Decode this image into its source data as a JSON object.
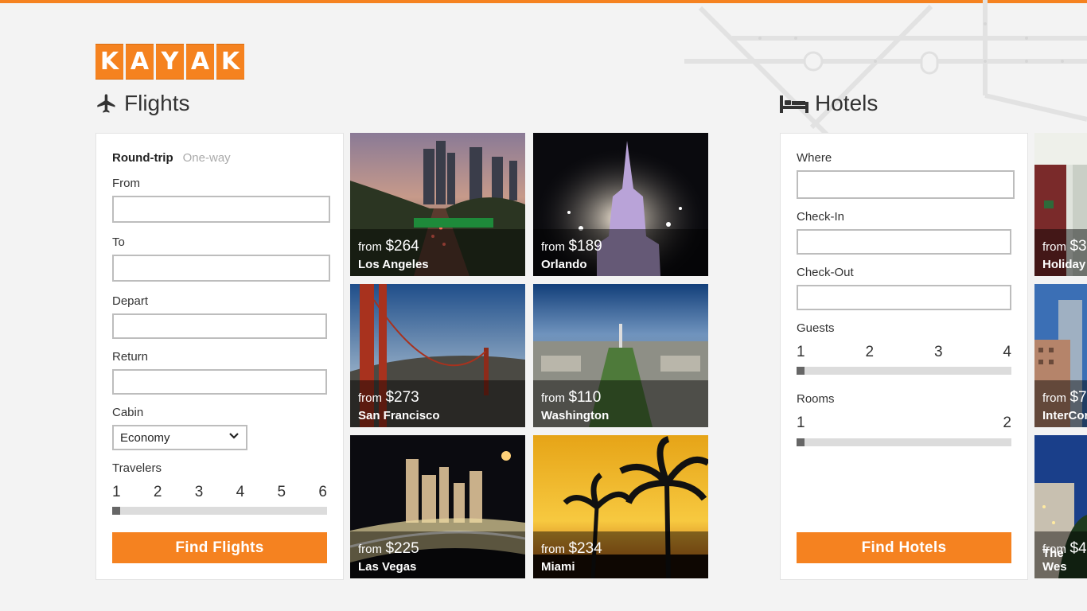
{
  "brand": {
    "logo_letters": [
      "K",
      "A",
      "Y",
      "A",
      "K"
    ],
    "accent": "#f58220"
  },
  "flights": {
    "title": "Flights",
    "trip_types": {
      "round_trip": "Round-trip",
      "one_way": "One-way"
    },
    "from_label": "From",
    "to_label": "To",
    "depart_label": "Depart",
    "return_label": "Return",
    "cabin_label": "Cabin",
    "cabin_value": "Economy",
    "travelers_label": "Travelers",
    "travelers_options": [
      "1",
      "2",
      "3",
      "4",
      "5",
      "6"
    ],
    "travelers_selected": 1,
    "button": "Find Flights"
  },
  "destinations": [
    {
      "from": "from",
      "price": "$264",
      "city": "Los Angeles"
    },
    {
      "from": "from",
      "price": "$189",
      "city": "Orlando"
    },
    {
      "from": "from",
      "price": "$273",
      "city": "San Francisco"
    },
    {
      "from": "from",
      "price": "$110",
      "city": "Washington"
    },
    {
      "from": "from",
      "price": "$225",
      "city": "Las Vegas"
    },
    {
      "from": "from",
      "price": "$234",
      "city": "Miami"
    }
  ],
  "hotels": {
    "title": "Hotels",
    "where_label": "Where",
    "checkin_label": "Check-In",
    "checkout_label": "Check-Out",
    "guests_label": "Guests",
    "guests_options": [
      "1",
      "2",
      "3",
      "4"
    ],
    "guests_selected": 1,
    "rooms_label": "Rooms",
    "rooms_options": [
      "1",
      "2"
    ],
    "rooms_selected": 1,
    "button": "Find Hotels"
  },
  "hotel_tiles": [
    {
      "from": "from",
      "price": "$3",
      "name": "Holiday"
    },
    {
      "from": "from",
      "price": "$7",
      "name": "InterCor"
    },
    {
      "from": "from",
      "price": "$4",
      "name": "The Wes"
    }
  ]
}
